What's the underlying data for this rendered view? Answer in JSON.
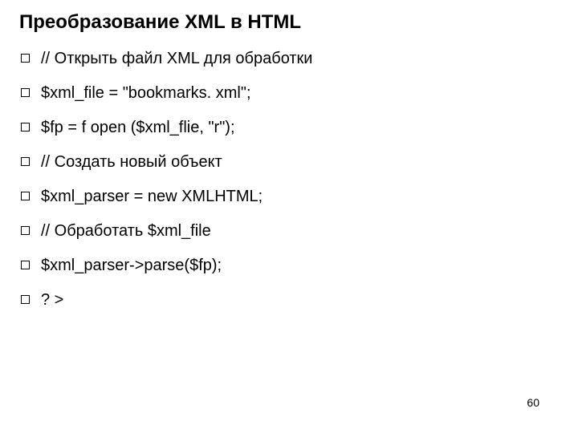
{
  "title": "Преобразование XML в HTML",
  "bullets": [
    "// Открыть файл XML для обработки",
    "$xml_file = \"bookmarks. xml\";",
    "$fp = f open ($xml_flie, \"r\");",
    "// Создать новый объект",
    "$xml_parser = new XMLHTML;",
    "// Обработать $xml_file",
    "$xml_parser->parse($fp);",
    "? >"
  ],
  "page_number": "60"
}
